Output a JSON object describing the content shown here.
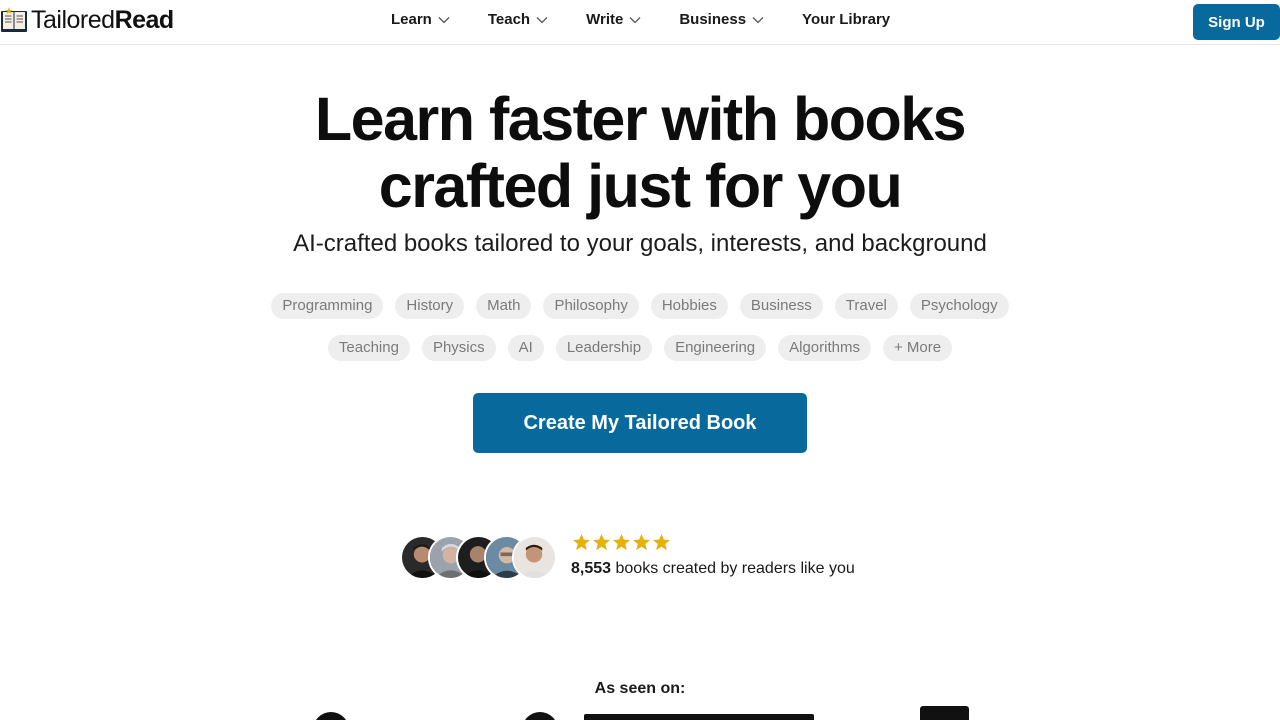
{
  "header": {
    "logo_text_light": "Tailored",
    "logo_text_bold": "Read",
    "nav": [
      {
        "label": "Learn",
        "icon": "chevron-down-icon"
      },
      {
        "label": "Teach",
        "icon": "chevron-down-icon"
      },
      {
        "label": "Write",
        "icon": "chevron-down-icon"
      },
      {
        "label": "Business",
        "icon": "chevron-down-icon"
      },
      {
        "label": "Your Library"
      }
    ],
    "signup_label": "Sign Up"
  },
  "hero": {
    "title_line1": "Learn faster with books",
    "title_line2": "crafted just for you",
    "subtitle": "AI-crafted books tailored to your goals, interests, and background",
    "topics_row1": [
      "Programming",
      "History",
      "Math",
      "Philosophy",
      "Hobbies",
      "Business",
      "Travel",
      "Psychology"
    ],
    "topics_row2": [
      "Teaching",
      "Physics",
      "AI",
      "Leadership",
      "Engineering",
      "Algorithms",
      "+ More"
    ],
    "cta_label": "Create My Tailored Book"
  },
  "social_proof": {
    "rating_stars": 5,
    "books_count": "8,553",
    "books_text": "books created by readers like you",
    "avatar_count": 5
  },
  "press": {
    "heading": "As seen on:"
  },
  "colors": {
    "brand": "#086a9c",
    "star": "#e8b10a",
    "chip_bg": "#eeeeee",
    "chip_text": "#7a7a7a"
  }
}
